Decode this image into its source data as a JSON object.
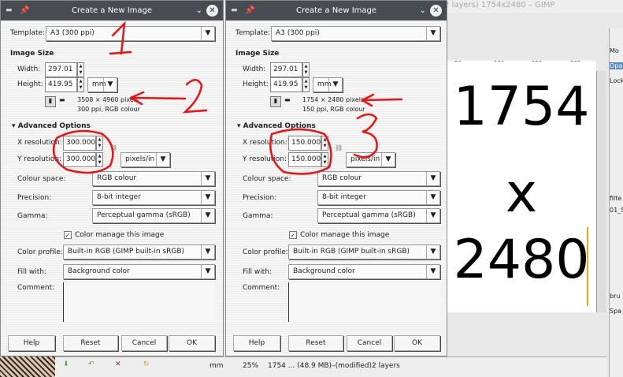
{
  "gimp": {
    "title": "2 layers) 1754x2480 – GIMP",
    "ruler_ticks": [
      "50",
      "100",
      "150",
      "200"
    ],
    "canvas_lines": [
      "1754",
      "x",
      "2480"
    ],
    "dock_labels": [
      "Mo",
      "Opa",
      "Lock",
      "filte",
      "01_S",
      "bru",
      "Spa"
    ],
    "status": {
      "unit": "mm",
      "zoom": "25%",
      "info": "1754 ... (48.9 MB)–(modified)2 layers"
    }
  },
  "dialogs": [
    {
      "title": "Create a New Image",
      "template_label": "Template:",
      "template": "A3 (300 ppi)",
      "image_size": "Image Size",
      "width_label": "Width:",
      "width": "297.01",
      "height_label": "Height:",
      "height": "419.95",
      "unit": "mm",
      "pixels": "3508 × 4960 pixels",
      "ppi_info": "300 ppi, RGB colour",
      "advanced": "Advanced Options",
      "xres_label": "X resolution:",
      "xres": "300.000",
      "yres_label": "Y resolution:",
      "yres": "300.000",
      "res_unit": "pixels/in",
      "colour_space_label": "Colour space:",
      "colour_space": "RGB colour",
      "precision_label": "Precision:",
      "precision": "8-bit integer",
      "gamma_label": "Gamma:",
      "gamma": "Perceptual gamma (sRGB)",
      "color_manage": "Color manage this image",
      "profile_label": "Color profile:",
      "profile": "Built-in RGB (GIMP built-in sRGB)",
      "fill_label": "Fill with:",
      "fill": "Background color",
      "comment_label": "Comment:",
      "help": "Help",
      "reset": "Reset",
      "cancel": "Cancel",
      "ok": "OK"
    },
    {
      "title": "Create a New Image",
      "template_label": "Template:",
      "template": "A3 (300 ppi)",
      "image_size": "Image Size",
      "width_label": "Width:",
      "width": "297.01",
      "height_label": "Height:",
      "height": "419.95",
      "unit": "mm",
      "pixels": "1754 × 2480 pixels",
      "ppi_info": "150 ppi, RGB colour",
      "advanced": "Advanced Options",
      "xres_label": "X resolution:",
      "xres": "150.000",
      "yres_label": "Y resolution:",
      "yres": "150.000",
      "res_unit": "pixels/in",
      "colour_space_label": "Colour space:",
      "colour_space": "RGB colour",
      "precision_label": "Precision:",
      "precision": "8-bit integer",
      "gamma_label": "Gamma:",
      "gamma": "Perceptual gamma (sRGB)",
      "color_manage": "Color manage this image",
      "profile_label": "Color profile:",
      "profile": "Built-in RGB (GIMP built-in sRGB)",
      "fill_label": "Fill with:",
      "fill": "Background color",
      "comment_label": "Comment:",
      "help": "Help",
      "reset": "Reset",
      "cancel": "Cancel",
      "ok": "OK"
    }
  ],
  "annotations": {
    "color": "#ee1111",
    "labels": [
      "1",
      "2",
      "3"
    ]
  }
}
